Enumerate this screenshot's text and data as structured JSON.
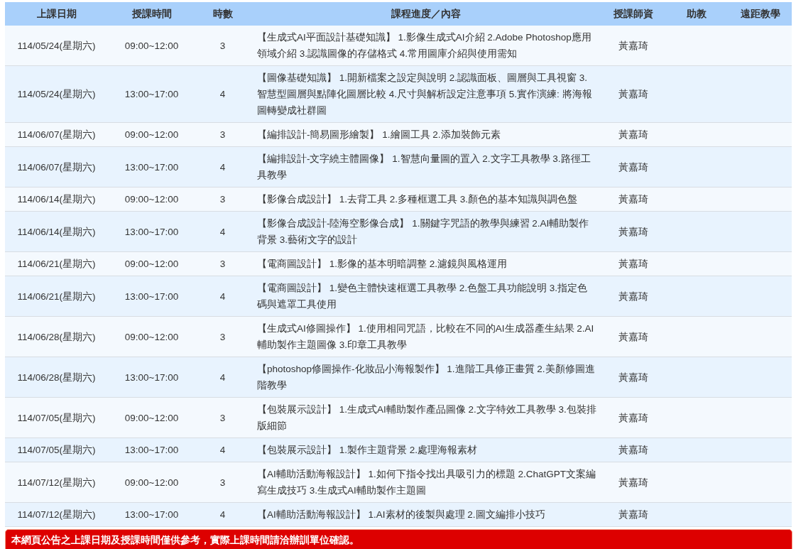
{
  "table": {
    "columns": [
      "上課日期",
      "授課時間",
      "時數",
      "課程進度／內容",
      "授課師資",
      "助教",
      "遠距教學"
    ],
    "rows": [
      {
        "date": "114/05/24(星期六)",
        "time": "09:00~12:00",
        "hours": "3",
        "content": "【生成式AI平面設計基礎知識】 1.影像生成式AI介紹 2.Adobe Photoshop應用領域介紹 3.認識圖像的存儲格式 4.常用圖庫介紹與使用需知",
        "teacher": "黃嘉琦"
      },
      {
        "date": "114/05/24(星期六)",
        "time": "13:00~17:00",
        "hours": "4",
        "content": "【圖像基礎知識】 1.開新檔案之設定與說明 2.認識面板、圖層與工具視窗 3.智慧型圖層與點陣化圖層比較 4.尺寸與解析設定注意事項 5.實作演練: 將海報圖轉變成社群圖",
        "teacher": "黃嘉琦"
      },
      {
        "date": "114/06/07(星期六)",
        "time": "09:00~12:00",
        "hours": "3",
        "content": "【編排設計-簡易圖形繪製】 1.繪圖工具 2.添加裝飾元素",
        "teacher": "黃嘉琦"
      },
      {
        "date": "114/06/07(星期六)",
        "time": "13:00~17:00",
        "hours": "4",
        "content": "【編排設計-文字繞主體圖像】 1.智慧向量圖的置入 2.文字工具教學 3.路徑工具教學",
        "teacher": "黃嘉琦"
      },
      {
        "date": "114/06/14(星期六)",
        "time": "09:00~12:00",
        "hours": "3",
        "content": "【影像合成設計】 1.去背工具 2.多種框選工具 3.顏色的基本知識與調色盤",
        "teacher": "黃嘉琦"
      },
      {
        "date": "114/06/14(星期六)",
        "time": "13:00~17:00",
        "hours": "4",
        "content": "【影像合成設計-陸海空影像合成】 1.關鍵字咒語的教學與練習 2.AI輔助製作背景 3.藝術文字的設計",
        "teacher": "黃嘉琦"
      },
      {
        "date": "114/06/21(星期六)",
        "time": "09:00~12:00",
        "hours": "3",
        "content": "【電商圖設計】 1.影像的基本明暗調整 2.濾鏡與風格運用",
        "teacher": "黃嘉琦"
      },
      {
        "date": "114/06/21(星期六)",
        "time": "13:00~17:00",
        "hours": "4",
        "content": "【電商圖設計】 1.變色主體快速框選工具教學 2.色盤工具功能說明 3.指定色碼與遮罩工具使用",
        "teacher": "黃嘉琦"
      },
      {
        "date": "114/06/28(星期六)",
        "time": "09:00~12:00",
        "hours": "3",
        "content": "【生成式AI修圖操作】 1.使用相同咒語，比較在不同的AI生成器產生結果 2.AI輔助製作主題圖像 3.印章工具教學",
        "teacher": "黃嘉琦"
      },
      {
        "date": "114/06/28(星期六)",
        "time": "13:00~17:00",
        "hours": "4",
        "content": "【photoshop修圖操作-化妝品小海報製作】 1.進階工具修正畫質 2.美顏修圖進階教學",
        "teacher": "黃嘉琦"
      },
      {
        "date": "114/07/05(星期六)",
        "time": "09:00~12:00",
        "hours": "3",
        "content": "【包裝展示設計】 1.生成式AI輔助製作產品圖像 2.文字特效工具教學 3.包裝排版細節",
        "teacher": "黃嘉琦"
      },
      {
        "date": "114/07/05(星期六)",
        "time": "13:00~17:00",
        "hours": "4",
        "content": "【包裝展示設計】 1.製作主題背景 2.處理海報素材",
        "teacher": "黃嘉琦"
      },
      {
        "date": "114/07/12(星期六)",
        "time": "09:00~12:00",
        "hours": "3",
        "content": "【AI輔助活動海報設計】 1.如何下指令找出具吸引力的標題 2.ChatGPT文案編寫生成技巧 3.生成式AI輔助製作主題圖",
        "teacher": "黃嘉琦"
      },
      {
        "date": "114/07/12(星期六)",
        "time": "13:00~17:00",
        "hours": "4",
        "content": "【AI輔助活動海報設計】 1.AI素材的後製與處理 2.圖文編排小技巧",
        "teacher": "黃嘉琦"
      }
    ]
  },
  "notice": "本網頁公告之上課日期及授課時間僅供參考，實際上課時間請洽辦訓單位確認。"
}
